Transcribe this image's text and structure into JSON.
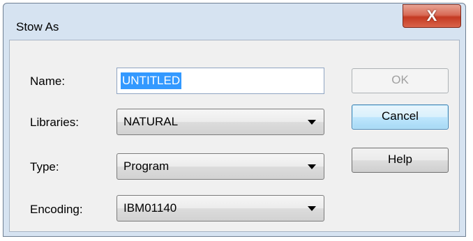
{
  "dialog": {
    "title": "Stow As",
    "close_label": "X"
  },
  "form": {
    "name_label": "Name:",
    "name_value": "UNTITLED",
    "libraries_label": "Libraries:",
    "libraries_value": "NATURAL",
    "type_label": "Type:",
    "type_value": "Program",
    "encoding_label": "Encoding:",
    "encoding_value": "IBM01140"
  },
  "buttons": {
    "ok": "OK",
    "cancel": "Cancel",
    "help": "Help"
  },
  "colors": {
    "selection": "#3399ff",
    "close_button": "#c43a22",
    "default_button_border": "#3c7fb1"
  },
  "icons": {
    "close": "close-icon",
    "dropdown": "chevron-down-icon"
  }
}
